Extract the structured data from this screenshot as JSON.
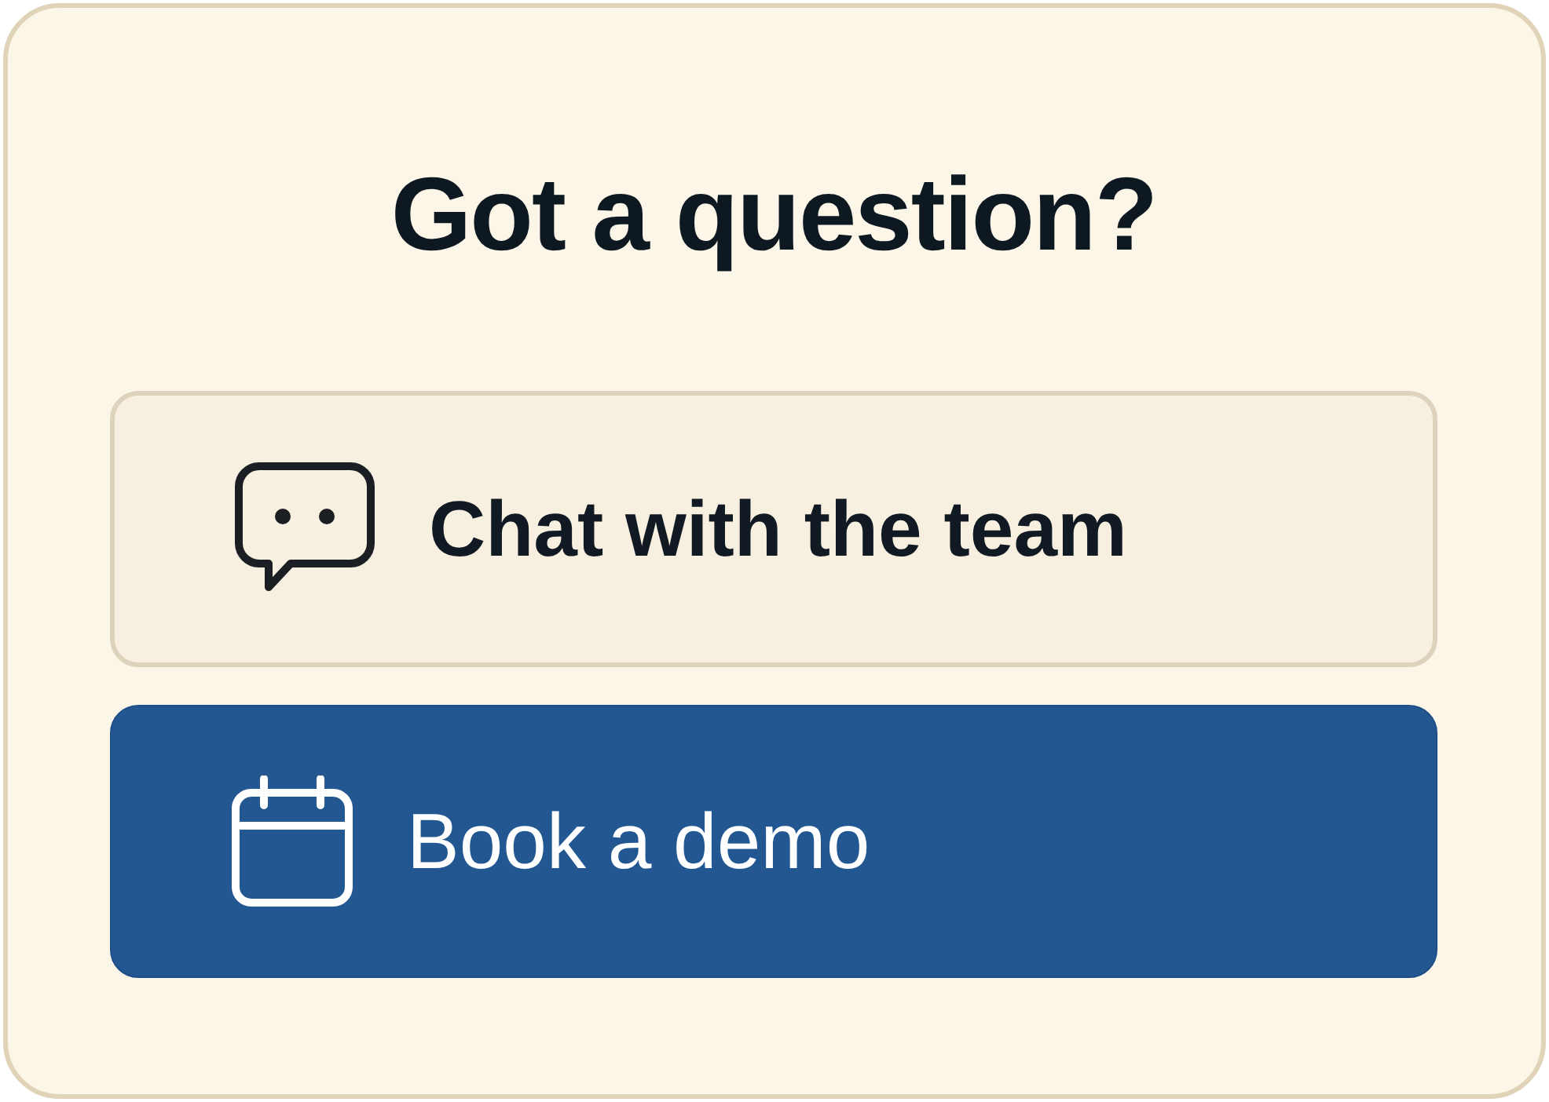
{
  "title": "Got a question?",
  "actions": [
    {
      "kind": "secondary",
      "label": "Chat with the team"
    },
    {
      "kind": "primary",
      "label": "Book a demo"
    }
  ]
}
